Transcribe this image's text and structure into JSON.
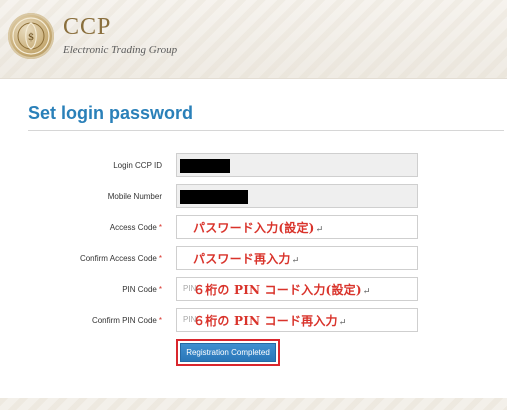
{
  "header": {
    "brand_name": "CCP",
    "brand_subtitle": "Electronic Trading Group",
    "logo_icon": "ccp-emblem-icon"
  },
  "page_title": "Set login password",
  "colors": {
    "title_blue": "#2a80b9",
    "required_red": "#d9332b",
    "button_blue": "#2a77b8",
    "highlight_red": "#d9262d"
  },
  "form": {
    "required_mark": "*",
    "fields": [
      {
        "label": "Login CCP ID",
        "required": false,
        "value": "",
        "redacted": true
      },
      {
        "label": "Mobile Number",
        "required": false,
        "value": "",
        "redacted": true
      },
      {
        "label": "Access Code",
        "required": true,
        "placeholder": "",
        "annotation": "パスワード入力(設定)"
      },
      {
        "label": "Confirm Access Code",
        "required": true,
        "placeholder": "",
        "annotation": "パスワード再入力"
      },
      {
        "label": "PIN Code",
        "required": true,
        "placeholder": "PIN",
        "annotation": "６桁の PIN コード入力(設定)"
      },
      {
        "label": "Confirm PIN Code",
        "required": true,
        "placeholder": "PIN",
        "annotation": "６桁の PIN コード再入力"
      }
    ],
    "annotation_mark": "↵"
  },
  "submit_label": "Registration Completed"
}
